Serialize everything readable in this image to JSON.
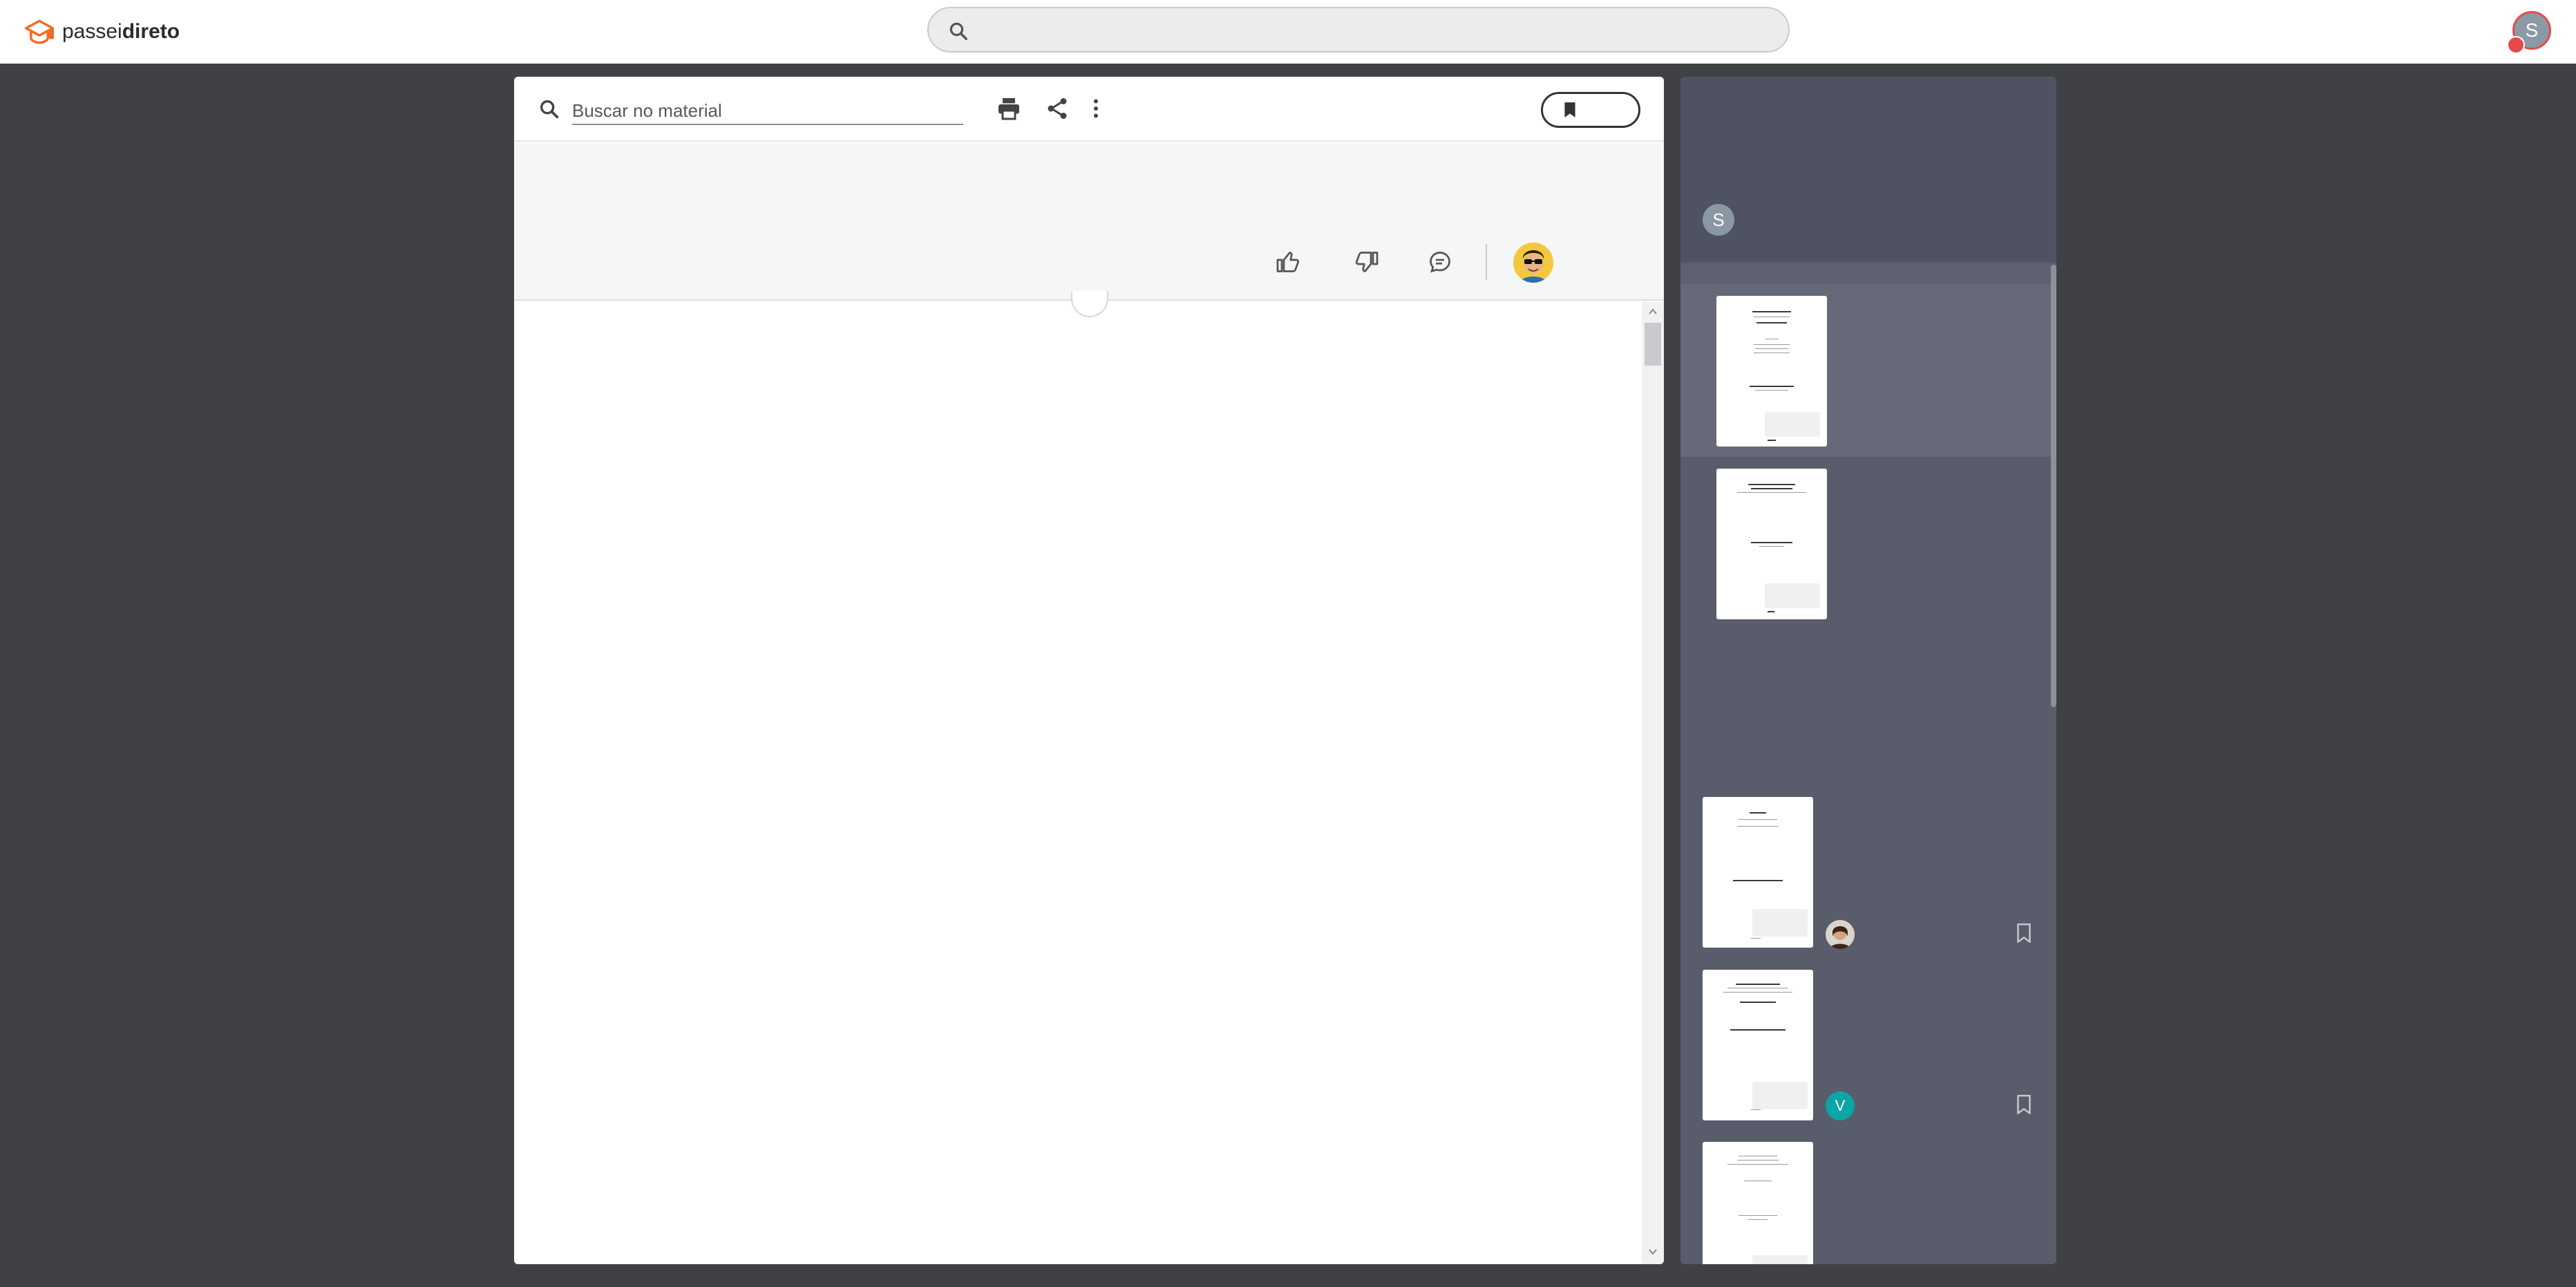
{
  "header": {
    "brand_light": "passei",
    "brand_bold": "direto",
    "search_placeholder": "",
    "user_initial": "S",
    "icons": {
      "logo": "graduation-cap-icon",
      "search": "search-icon"
    }
  },
  "document": {
    "search_placeholder": "Buscar no material",
    "toolbar_icons": [
      "print-icon",
      "share-icon",
      "more-vertical-icon",
      "bookmark-icon"
    ],
    "action_icons": [
      "thumbs-up-icon",
      "thumbs-down-icon",
      "comment-icon"
    ]
  },
  "sidebar": {
    "user_initial": "S",
    "related": [
      {
        "author_initial": "",
        "author_color": "#8b5a44"
      },
      {
        "author_initial": "V",
        "author_color": "#0aa5a5"
      },
      {
        "author_initial": "",
        "author_color": ""
      }
    ]
  },
  "colors": {
    "background": "#3f4144",
    "sidebar": "#595c6a",
    "brand_orange": "#f26b21",
    "accent_teal": "#0aa5a5"
  }
}
